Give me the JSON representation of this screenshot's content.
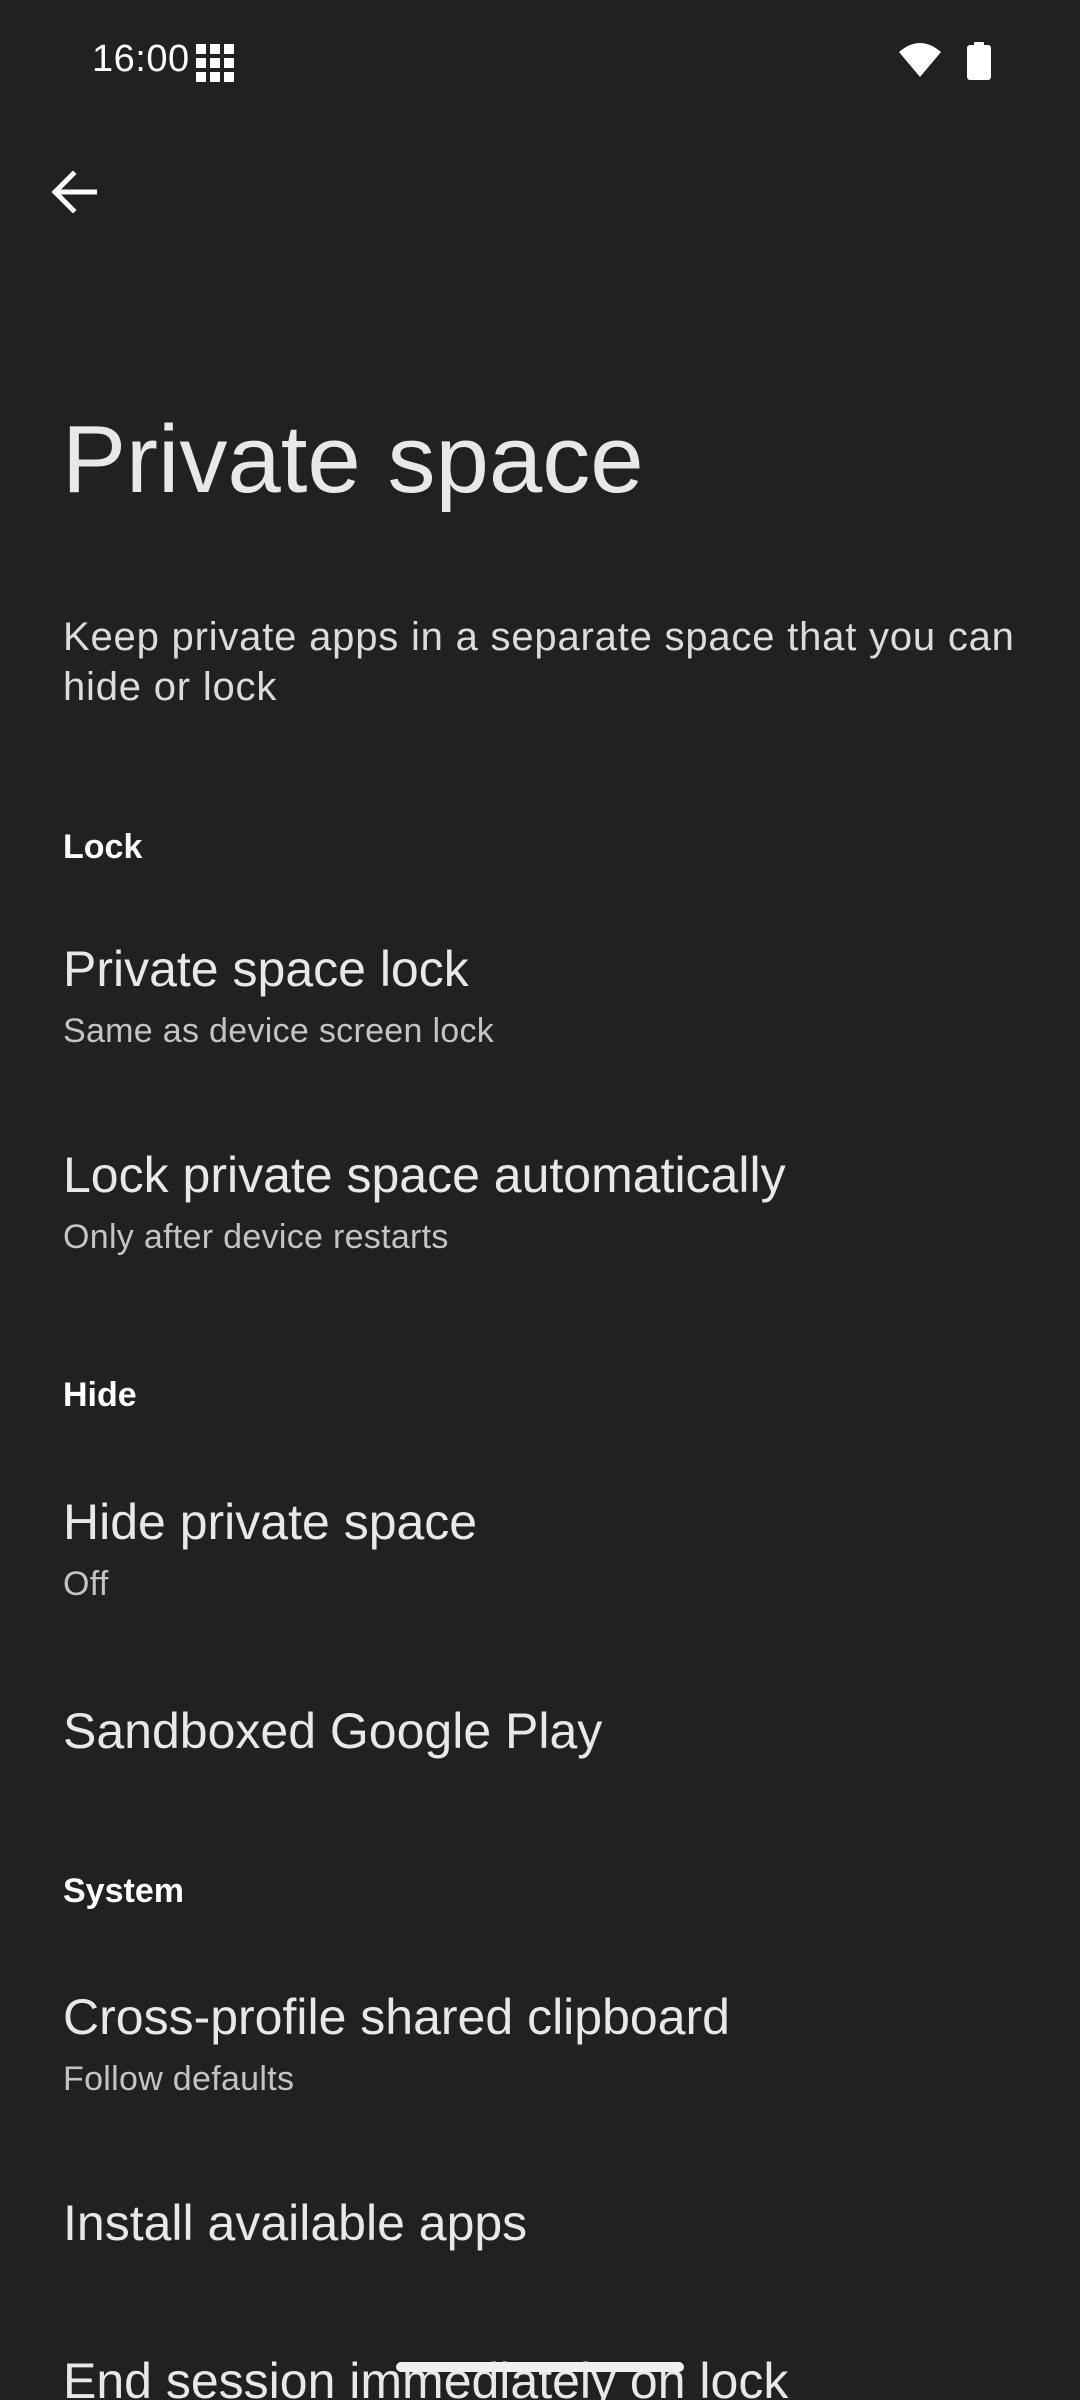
{
  "status_bar": {
    "time": "16:00",
    "icons": [
      "grid-icon",
      "wifi-icon",
      "battery-icon"
    ]
  },
  "toolbar": {
    "back_icon": "arrow-left-icon"
  },
  "page": {
    "title": "Private space",
    "description": "Keep private apps in a separate space that you can hide or lock"
  },
  "sections": {
    "lock": {
      "header": "Lock",
      "items": [
        {
          "title": "Private space lock",
          "summary": "Same as device screen lock"
        },
        {
          "title": "Lock private space automatically",
          "summary": "Only after device restarts"
        }
      ]
    },
    "hide": {
      "header": "Hide",
      "items": [
        {
          "title": "Hide private space",
          "summary": "Off"
        },
        {
          "title": "Sandboxed Google Play"
        }
      ]
    },
    "system": {
      "header": "System",
      "items": [
        {
          "title": "Cross-profile shared clipboard",
          "summary": "Follow defaults"
        },
        {
          "title": "Install available apps"
        },
        {
          "title": "End session immediately on lock"
        }
      ]
    }
  },
  "colors": {
    "background": "#212121",
    "text_primary": "#e8e8e8",
    "text_secondary": "#c4c4c4"
  }
}
